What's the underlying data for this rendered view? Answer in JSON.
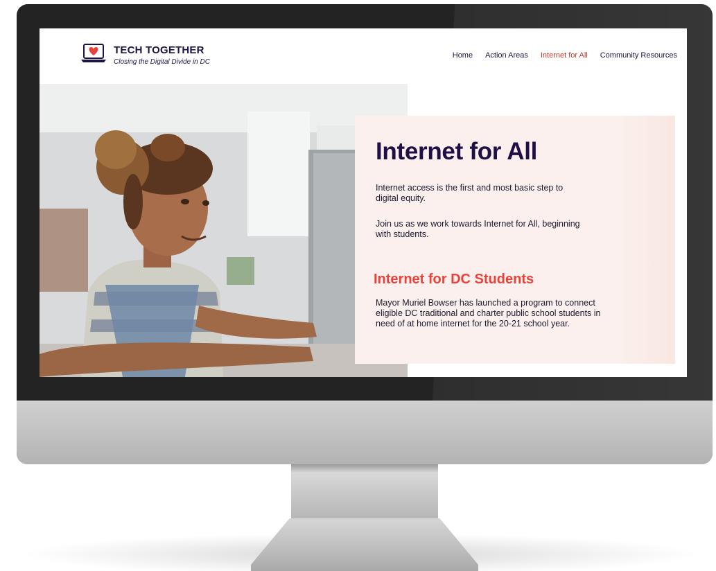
{
  "brand": {
    "name": "TECH TOGETHER",
    "tagline": "Closing the Digital Divide in DC"
  },
  "nav": {
    "items": [
      {
        "label": "Home",
        "active": false
      },
      {
        "label": "Action Areas",
        "active": false
      },
      {
        "label": "Internet for All",
        "active": true
      },
      {
        "label": "Community Resources",
        "active": false
      }
    ]
  },
  "hero": {
    "image": "girl-using-laptop"
  },
  "content": {
    "title": "Internet for All",
    "intro": "Internet access is the first and most basic step to digital equity.",
    "cta": "Join us as we work towards Internet for All, beginning with students.",
    "section_title": "Internet for DC Students",
    "section_body": "Mayor Muriel Bowser has launched a program to connect eligible DC traditional and charter public school students in need of at home internet for the 20-21 school year."
  },
  "colors": {
    "navy": "#1e1345",
    "accent_red": "#e8433b",
    "active_nav": "#c0392b",
    "panel_bg": "#fbf0ed",
    "bezel": "#232323"
  }
}
